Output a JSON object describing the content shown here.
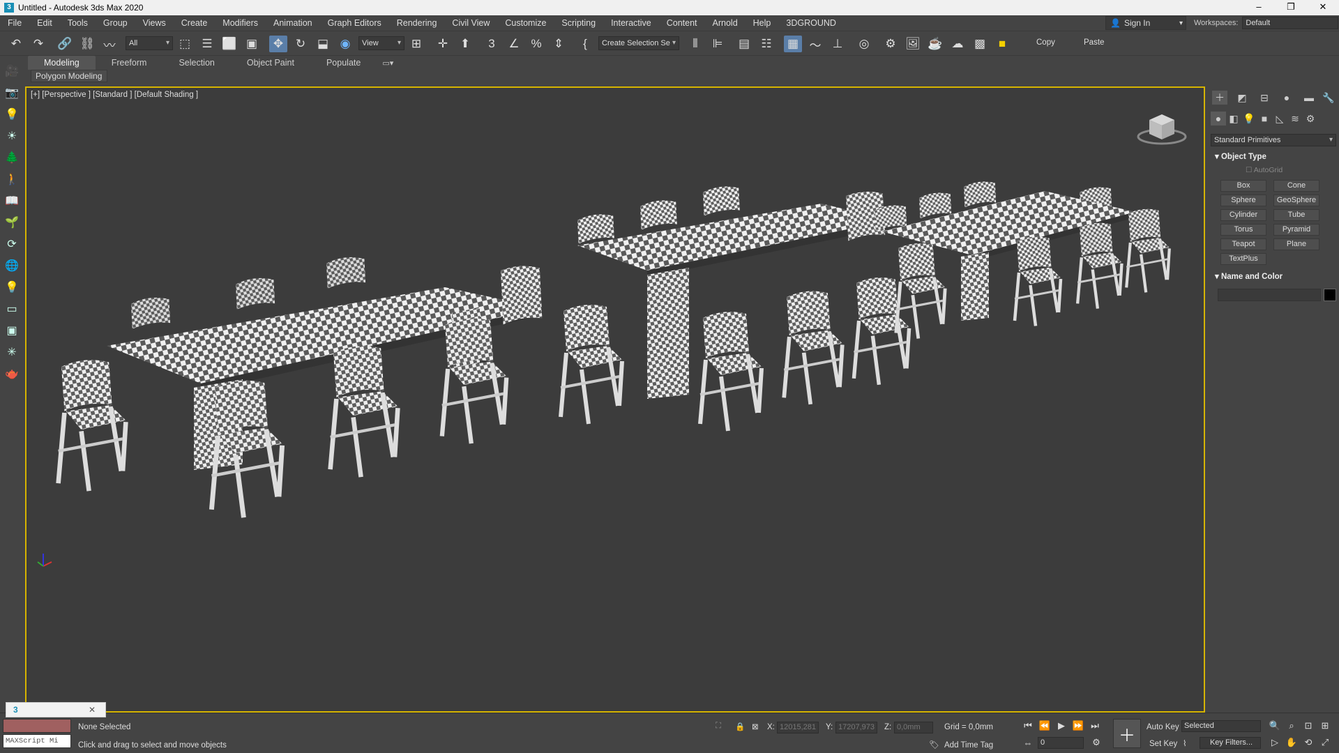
{
  "window": {
    "title": "Untitled - Autodesk 3ds Max 2020",
    "icon": "3"
  },
  "menubar": [
    "File",
    "Edit",
    "Tools",
    "Group",
    "Views",
    "Create",
    "Modifiers",
    "Animation",
    "Graph Editors",
    "Rendering",
    "Civil View",
    "Customize",
    "Scripting",
    "Interactive",
    "Content",
    "Arnold",
    "Help",
    "3DGROUND"
  ],
  "account": {
    "signin": "Sign In"
  },
  "workspaces": {
    "label": "Workspaces:",
    "value": "Default"
  },
  "toolbar": {
    "filter": "All",
    "refcoord": "View",
    "selection_set": "Create Selection Se",
    "copy": "Copy",
    "paste": "Paste"
  },
  "ribbon": {
    "tabs": [
      "Modeling",
      "Freeform",
      "Selection",
      "Object Paint",
      "Populate"
    ],
    "active": "Modeling",
    "sub": "Polygon Modeling"
  },
  "viewport": {
    "label": "[+] [Perspective ] [Standard ] [Default Shading ]"
  },
  "command_panel": {
    "category": "Standard Primitives",
    "object_type": {
      "title": "Object Type",
      "autogrid": "AutoGrid",
      "buttons": [
        "Box",
        "Cone",
        "Sphere",
        "GeoSphere",
        "Cylinder",
        "Tube",
        "Torus",
        "Pyramid",
        "Teapot",
        "Plane",
        "TextPlus"
      ]
    },
    "name_color": {
      "title": "Name and Color"
    }
  },
  "status": {
    "selection": "None Selected",
    "prompt": "Click and drag to select and move objects",
    "maxscript": "MAXScript Mi",
    "x_label": "X:",
    "x_value": "12015,281",
    "y_label": "Y:",
    "y_value": "17207,973",
    "z_label": "Z:",
    "z_value": "0,0mm",
    "grid": "Grid = 0,0mm",
    "add_time_tag": "Add Time Tag",
    "auto_key": "Auto Key",
    "selected": "Selected",
    "set_key": "Set Key",
    "key_filters": "Key Filters...",
    "frame": "0"
  }
}
